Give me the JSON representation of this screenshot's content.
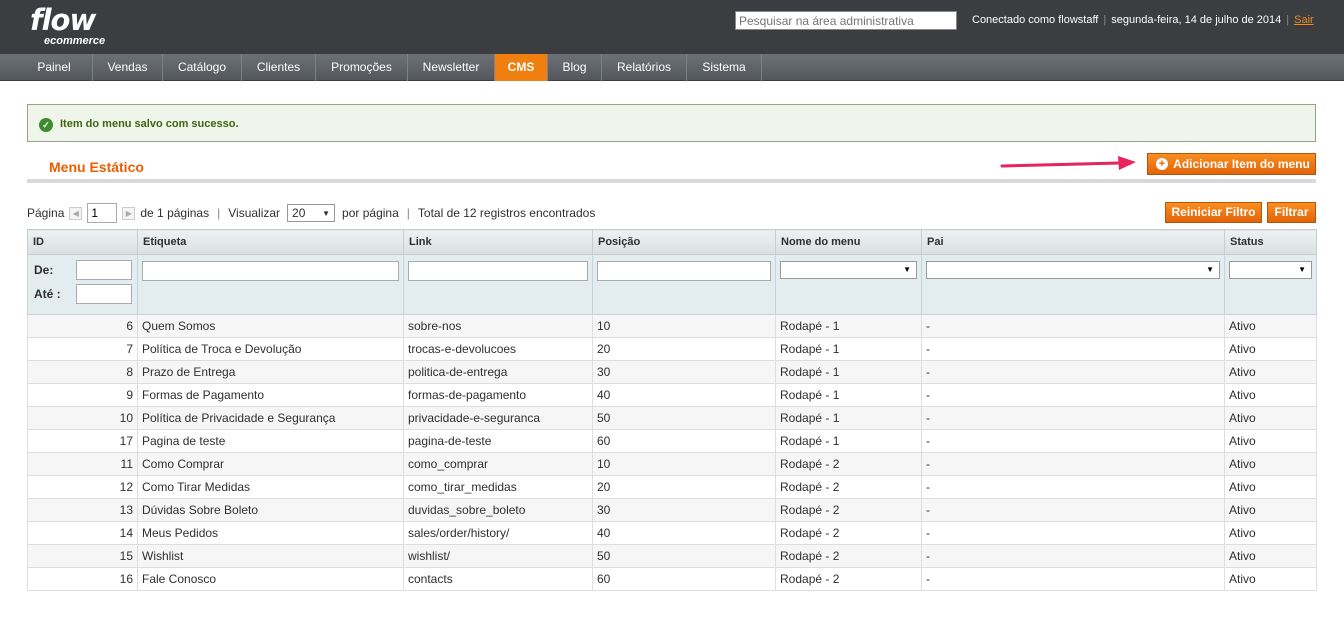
{
  "header": {
    "logo_main": "flow",
    "logo_sub": "ecommerce",
    "search_placeholder": "Pesquisar na área administrativa",
    "logged_in": "Conectado como flowstaff",
    "date": "segunda-feira, 14 de julho de 2014",
    "logout": "Sair"
  },
  "nav": {
    "items": [
      "Painel",
      "Vendas",
      "Catálogo",
      "Clientes",
      "Promoções",
      "Newsletter",
      "CMS",
      "Blog",
      "Relatórios",
      "Sistema"
    ],
    "active": "CMS"
  },
  "message": {
    "text": "Item do menu salvo com sucesso."
  },
  "page": {
    "title": "Menu Estático",
    "add_button": "Adicionar Item do menu"
  },
  "pager": {
    "page_label": "Página",
    "page_value": "1",
    "of_pages": "de 1 páginas",
    "view_label": "Visualizar",
    "per_page_value": "20",
    "per_page_label": "por página",
    "total": "Total de 12 registros encontrados",
    "reset_button": "Reiniciar Filtro",
    "filter_button": "Filtrar"
  },
  "grid": {
    "columns": [
      "ID",
      "Etiqueta",
      "Link",
      "Posição",
      "Nome do menu",
      "Pai",
      "Status"
    ],
    "filter_from": "De:",
    "filter_to": "Até :",
    "rows": [
      [
        "6",
        "Quem Somos",
        "sobre-nos",
        "10",
        "Rodapé - 1",
        "-",
        "Ativo"
      ],
      [
        "7",
        "Política de Troca e Devolução",
        "trocas-e-devolucoes",
        "20",
        "Rodapé - 1",
        "-",
        "Ativo"
      ],
      [
        "8",
        "Prazo de Entrega",
        "politica-de-entrega",
        "30",
        "Rodapé - 1",
        "-",
        "Ativo"
      ],
      [
        "9",
        "Formas de Pagamento",
        "formas-de-pagamento",
        "40",
        "Rodapé - 1",
        "-",
        "Ativo"
      ],
      [
        "10",
        "Política de Privacidade e Segurança",
        "privacidade-e-seguranca",
        "50",
        "Rodapé - 1",
        "-",
        "Ativo"
      ],
      [
        "17",
        "Pagina de teste",
        "pagina-de-teste",
        "60",
        "Rodapé - 1",
        "-",
        "Ativo"
      ],
      [
        "11",
        "Como Comprar",
        "como_comprar",
        "10",
        "Rodapé - 2",
        "-",
        "Ativo"
      ],
      [
        "12",
        "Como Tirar Medidas",
        "como_tirar_medidas",
        "20",
        "Rodapé - 2",
        "-",
        "Ativo"
      ],
      [
        "13",
        "Dúvidas Sobre Boleto",
        "duvidas_sobre_boleto",
        "30",
        "Rodapé - 2",
        "-",
        "Ativo"
      ],
      [
        "14",
        "Meus Pedidos",
        "sales/order/history/",
        "40",
        "Rodapé - 2",
        "-",
        "Ativo"
      ],
      [
        "15",
        "Wishlist",
        "wishlist/",
        "50",
        "Rodapé - 2",
        "-",
        "Ativo"
      ],
      [
        "16",
        "Fale Conosco",
        "contacts",
        "60",
        "Rodapé - 2",
        "-",
        "Ativo"
      ]
    ]
  }
}
